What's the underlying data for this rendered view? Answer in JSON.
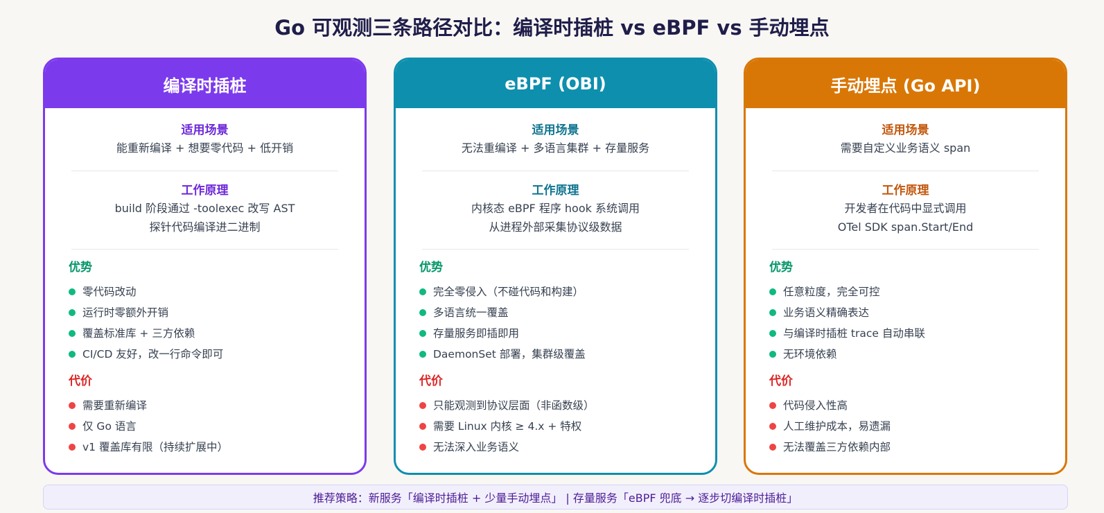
{
  "title": "Go 可观测三条路径对比：编译时插桩 vs eBPF vs 手动埋点",
  "colors": {
    "compile": "#7c3aed",
    "ebpf": "#0e8fae",
    "manual": "#d97706",
    "pros": "#10b981",
    "cons": "#ef4444"
  },
  "cards": [
    {
      "header": "编译时插桩",
      "scene_title": "适用场景",
      "scene_text": "能重新编译 + 想要零代码 + 低开销",
      "principle_title": "工作原理",
      "principle_lines": [
        "build 阶段通过 -toolexec 改写 AST",
        "探针代码编译进二进制"
      ],
      "pros_title": "优势",
      "pros": [
        "零代码改动",
        "运行时零额外开销",
        "覆盖标准库 + 三方依赖",
        "CI/CD 友好，改一行命令即可"
      ],
      "cons_title": "代价",
      "cons": [
        "需要重新编译",
        "仅 Go 语言",
        "v1 覆盖库有限（持续扩展中）"
      ]
    },
    {
      "header": "eBPF (OBI)",
      "scene_title": "适用场景",
      "scene_text": "无法重编译 + 多语言集群 + 存量服务",
      "principle_title": "工作原理",
      "principle_lines": [
        "内核态 eBPF 程序 hook 系统调用",
        "从进程外部采集协议级数据"
      ],
      "pros_title": "优势",
      "pros": [
        "完全零侵入（不碰代码和构建）",
        "多语言统一覆盖",
        "存量服务即插即用",
        "DaemonSet 部署，集群级覆盖"
      ],
      "cons_title": "代价",
      "cons": [
        "只能观测到协议层面（非函数级）",
        "需要 Linux 内核 ≥ 4.x + 特权",
        "无法深入业务语义"
      ]
    },
    {
      "header": "手动埋点 (Go API)",
      "scene_title": "适用场景",
      "scene_text": "需要自定义业务语义 span",
      "principle_title": "工作原理",
      "principle_lines": [
        "开发者在代码中显式调用",
        "OTel SDK span.Start/End"
      ],
      "pros_title": "优势",
      "pros": [
        "任意粒度，完全可控",
        "业务语义精确表达",
        "与编译时插桩 trace 自动串联",
        "无环境依赖"
      ],
      "cons_title": "代价",
      "cons": [
        "代码侵入性高",
        "人工维护成本，易遗漏",
        "无法覆盖三方依赖内部"
      ]
    }
  ],
  "footer": "推荐策略：新服务「编译时插桩 + 少量手动埋点」 | 存量服务「eBPF 兜底 → 逐步切编译时插桩」"
}
